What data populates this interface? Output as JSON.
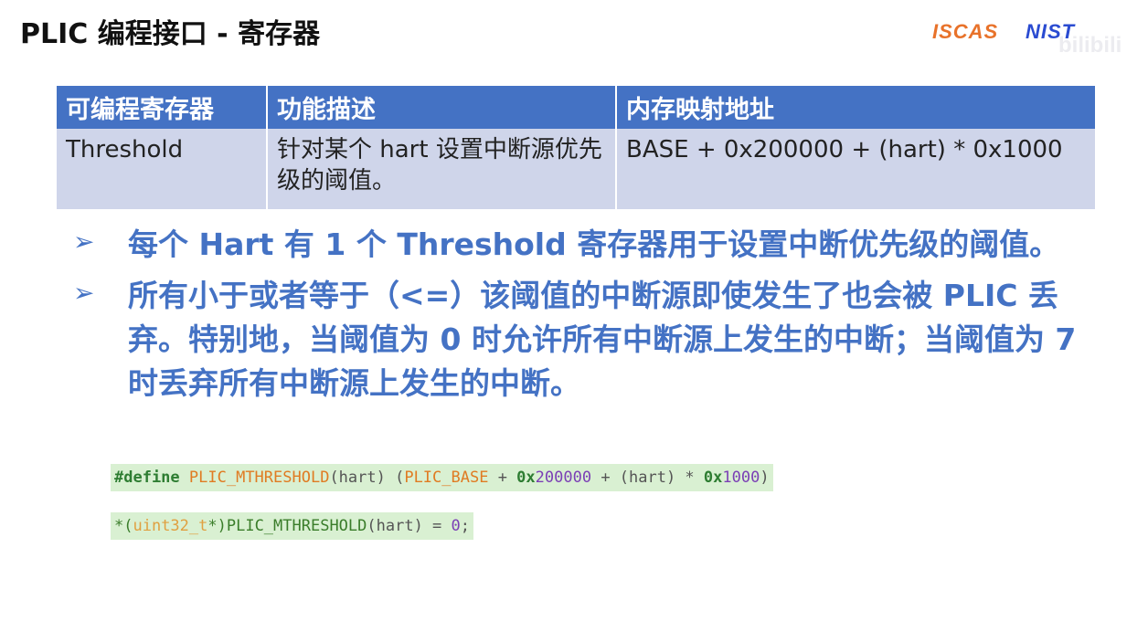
{
  "slide": {
    "title": "PLIC 编程接口 - 寄存器"
  },
  "logos": {
    "iscas": "ISCAS",
    "nist": "NIST",
    "watermark": "bilibili"
  },
  "table": {
    "headers": [
      "可编程寄存器",
      "功能描述",
      "内存映射地址"
    ],
    "rows": [
      [
        "Threshold",
        "针对某个 hart 设置中断源优先级的阈值。",
        "BASE + 0x200000 + (hart) * 0x1000"
      ]
    ]
  },
  "bullets": [
    {
      "marker": "➢",
      "text": "每个 Hart 有 1 个 Threshold 寄存器用于设置中断优先级的阈值。"
    },
    {
      "marker": "➢",
      "text": "所有小于或者等于（<=）该阈值的中断源即使发生了也会被 PLIC 丢弃。特别地，当阈值为 0 时允许所有中断源上发生的中断；当阈值为 7 时丢弃所有中断源上发生的中断。"
    }
  ],
  "code": {
    "line1": {
      "directive": "#define",
      "macro": "PLIC_MTHRESHOLD",
      "args": "(hart) (",
      "base": "PLIC_BASE",
      "plus1": " + ",
      "hex1_prefix": "0x",
      "hex1_digits": "200000",
      "plus2": " + (hart) * ",
      "hex2_prefix": "0x",
      "hex2_digits": "1000",
      "close": ")"
    },
    "line2": {
      "lead": "*(",
      "type": "uint32_t",
      "cast_close": "*)",
      "macro": "PLIC_MTHRESHOLD",
      "rest": "(hart) = ",
      "value": "0",
      "end": ";"
    }
  }
}
